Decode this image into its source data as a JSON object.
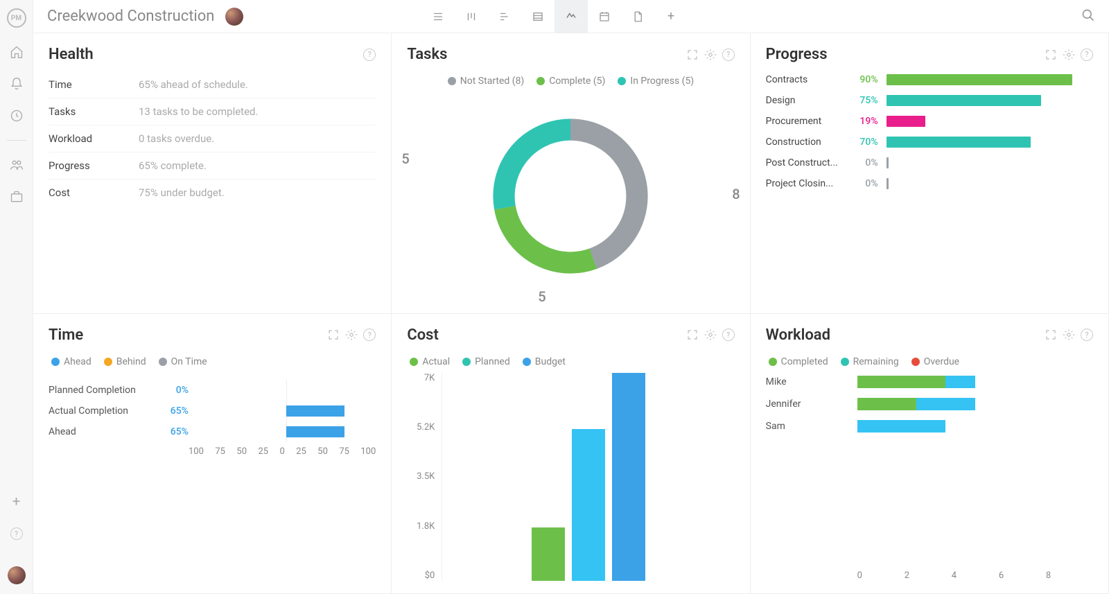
{
  "project": {
    "title": "Creekwood Construction"
  },
  "colors": {
    "grey": "#9aa0a6",
    "green": "#6cc04a",
    "teal": "#2fc4b2",
    "blue": "#3ba2e8",
    "skyblue": "#35c3f3",
    "orange": "#f5a623",
    "magenta": "#e91e8c",
    "red": "#e74c3c"
  },
  "health": {
    "title": "Health",
    "rows": [
      {
        "label": "Time",
        "value": "65% ahead of schedule."
      },
      {
        "label": "Tasks",
        "value": "13 tasks to be completed."
      },
      {
        "label": "Workload",
        "value": "0 tasks overdue."
      },
      {
        "label": "Progress",
        "value": "65% complete."
      },
      {
        "label": "Cost",
        "value": "75% under budget."
      }
    ]
  },
  "tasks": {
    "title": "Tasks",
    "legend": [
      {
        "label": "Not Started (8)",
        "color": "#9aa0a6",
        "value": 8
      },
      {
        "label": "Complete (5)",
        "color": "#6cc04a",
        "value": 5
      },
      {
        "label": "In Progress (5)",
        "color": "#2fc4b2",
        "value": 5
      }
    ],
    "donut_labels": {
      "right": "8",
      "bottom": "5",
      "left": "5"
    }
  },
  "progress": {
    "title": "Progress",
    "rows": [
      {
        "name": "Contracts",
        "pct": 90,
        "color": "#6cc04a",
        "pctColor": "#6cc04a"
      },
      {
        "name": "Design",
        "pct": 75,
        "color": "#2fc4b2",
        "pctColor": "#2fc4b2"
      },
      {
        "name": "Procurement",
        "pct": 19,
        "color": "#e91e8c",
        "pctColor": "#e91e8c"
      },
      {
        "name": "Construction",
        "pct": 70,
        "color": "#2fc4b2",
        "pctColor": "#2fc4b2"
      },
      {
        "name": "Post Construct...",
        "pct": 0,
        "color": "#9aa0a6",
        "pctColor": "#9aa0a6"
      },
      {
        "name": "Project Closin...",
        "pct": 0,
        "color": "#9aa0a6",
        "pctColor": "#9aa0a6"
      }
    ]
  },
  "time": {
    "title": "Time",
    "legend": [
      {
        "label": "Ahead",
        "color": "#3ba2e8"
      },
      {
        "label": "Behind",
        "color": "#f5a623"
      },
      {
        "label": "On Time",
        "color": "#9aa0a6"
      }
    ],
    "rows": [
      {
        "label": "Planned Completion",
        "pct": 0
      },
      {
        "label": "Actual Completion",
        "pct": 65
      },
      {
        "label": "Ahead",
        "pct": 65
      }
    ],
    "axis": [
      "100",
      "75",
      "50",
      "25",
      "0",
      "25",
      "50",
      "75",
      "100"
    ]
  },
  "cost": {
    "title": "Cost",
    "legend": [
      {
        "label": "Actual",
        "color": "#6cc04a"
      },
      {
        "label": "Planned",
        "color": "#2fc4b2"
      },
      {
        "label": "Budget",
        "color": "#3ba2e8"
      }
    ],
    "y_ticks": [
      "7K",
      "5.2K",
      "3.5K",
      "1.8K",
      "$0"
    ],
    "bars": [
      {
        "name": "Actual",
        "value": 1.8,
        "color": "#6cc04a"
      },
      {
        "name": "Planned",
        "value": 5.1,
        "color": "#35c3f3"
      },
      {
        "name": "Budget",
        "value": 7.0,
        "color": "#3ba2e8"
      }
    ],
    "ymax": 7.0
  },
  "workload": {
    "title": "Workload",
    "legend": [
      {
        "label": "Completed",
        "color": "#6cc04a"
      },
      {
        "label": "Remaining",
        "color": "#2fc4b2"
      },
      {
        "label": "Overdue",
        "color": "#e74c3c"
      }
    ],
    "max": 8,
    "rows": [
      {
        "name": "Mike",
        "segments": [
          {
            "v": 3.0,
            "color": "#6cc04a"
          },
          {
            "v": 1.0,
            "color": "#35c3f3"
          }
        ]
      },
      {
        "name": "Jennifer",
        "segments": [
          {
            "v": 2.0,
            "color": "#6cc04a"
          },
          {
            "v": 2.0,
            "color": "#35c3f3"
          }
        ]
      },
      {
        "name": "Sam",
        "segments": [
          {
            "v": 3.0,
            "color": "#35c3f3"
          }
        ]
      }
    ],
    "axis": [
      "0",
      "2",
      "4",
      "6",
      "8"
    ]
  },
  "chart_data": [
    {
      "type": "pie",
      "title": "Tasks",
      "categories": [
        "Not Started",
        "Complete",
        "In Progress"
      ],
      "values": [
        8,
        5,
        5
      ]
    },
    {
      "type": "bar",
      "title": "Progress",
      "categories": [
        "Contracts",
        "Design",
        "Procurement",
        "Construction",
        "Post Construction",
        "Project Closing"
      ],
      "values": [
        90,
        75,
        19,
        70,
        0,
        0
      ],
      "ylabel": "%",
      "ylim": [
        0,
        100
      ]
    },
    {
      "type": "bar",
      "title": "Time",
      "categories": [
        "Planned Completion",
        "Actual Completion",
        "Ahead"
      ],
      "values": [
        0,
        65,
        65
      ],
      "ylabel": "%",
      "ylim": [
        -100,
        100
      ]
    },
    {
      "type": "bar",
      "title": "Cost",
      "categories": [
        "Actual",
        "Planned",
        "Budget"
      ],
      "values": [
        1.8,
        5.1,
        7.0
      ],
      "ylabel": "K",
      "ylim": [
        0,
        7
      ]
    },
    {
      "type": "bar",
      "title": "Workload",
      "categories": [
        "Mike",
        "Jennifer",
        "Sam"
      ],
      "series": [
        {
          "name": "Completed",
          "values": [
            3,
            2,
            0
          ]
        },
        {
          "name": "Remaining",
          "values": [
            1,
            2,
            3
          ]
        },
        {
          "name": "Overdue",
          "values": [
            0,
            0,
            0
          ]
        }
      ],
      "xlabel": "",
      "ylim": [
        0,
        8
      ]
    }
  ]
}
